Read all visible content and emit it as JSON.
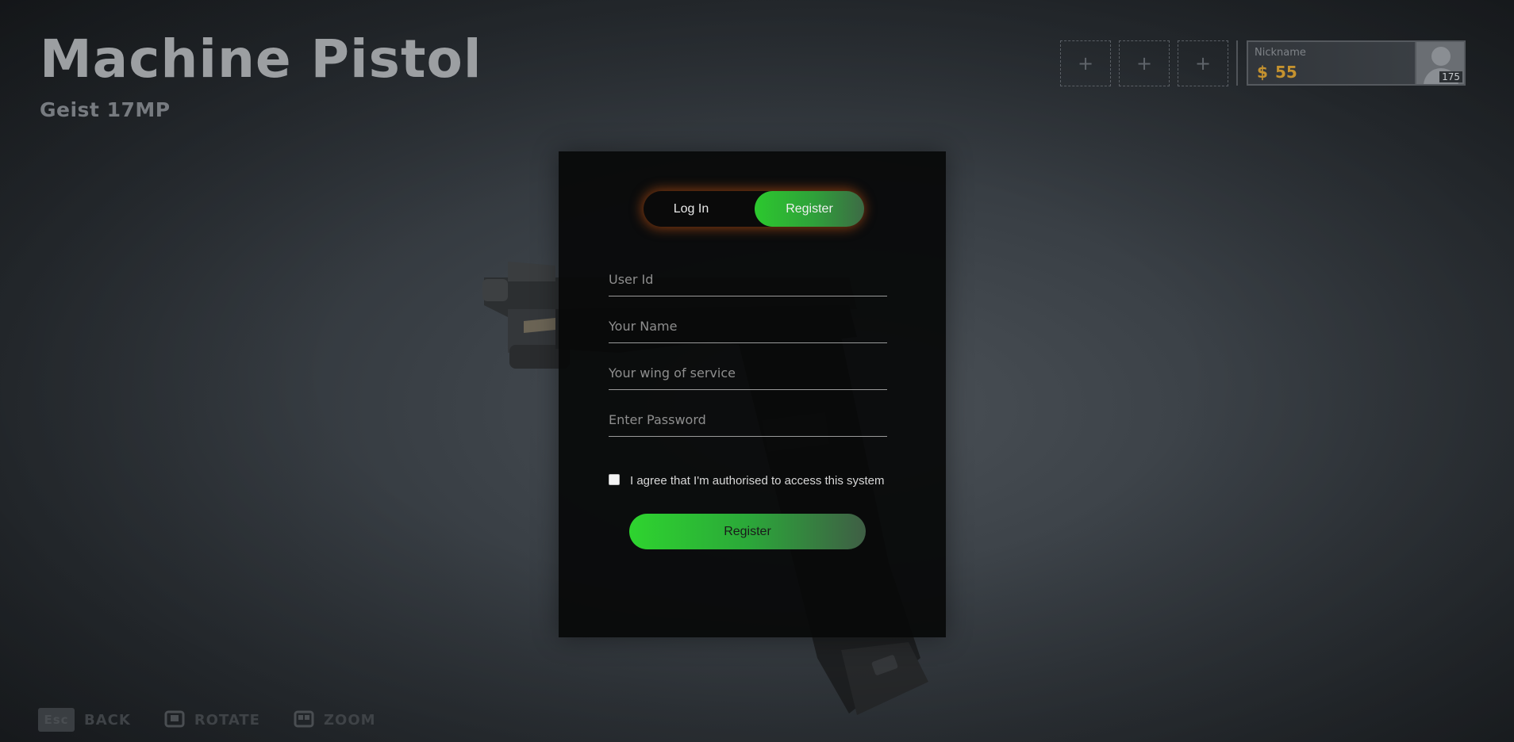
{
  "header": {
    "title": "Machine Pistol",
    "subtitle": "Geist 17MP"
  },
  "slots": [
    {
      "icon": "plus-icon",
      "label": "+"
    },
    {
      "icon": "plus-icon",
      "label": "+"
    },
    {
      "icon": "plus-icon",
      "label": "+"
    }
  ],
  "profile": {
    "nickname": "Nickname",
    "currency_icon": "coin-icon",
    "currency_glyph": "$",
    "credits": "55",
    "level": "175",
    "avatar_icon": "user-avatar-icon"
  },
  "auth": {
    "tabs": {
      "login": "Log In",
      "register": "Register",
      "active": "register"
    },
    "fields": {
      "user_id": "User Id",
      "name": "Your Name",
      "wing": "Your wing of service",
      "password": "Enter Password"
    },
    "agree": {
      "label": "I agree that I'm authorised to access this system",
      "checked": false
    },
    "submit": "Register"
  },
  "footer": {
    "back": {
      "key": "Esc",
      "label": "BACK"
    },
    "rotate": {
      "icon": "rotate-icon",
      "label": "ROTATE"
    },
    "zoom": {
      "icon": "zoom-icon",
      "label": "ZOOM"
    }
  },
  "colors": {
    "accent_green": "#2cc82e",
    "credits_gold": "#c5922f",
    "toggle_glow": "#d25a14"
  }
}
